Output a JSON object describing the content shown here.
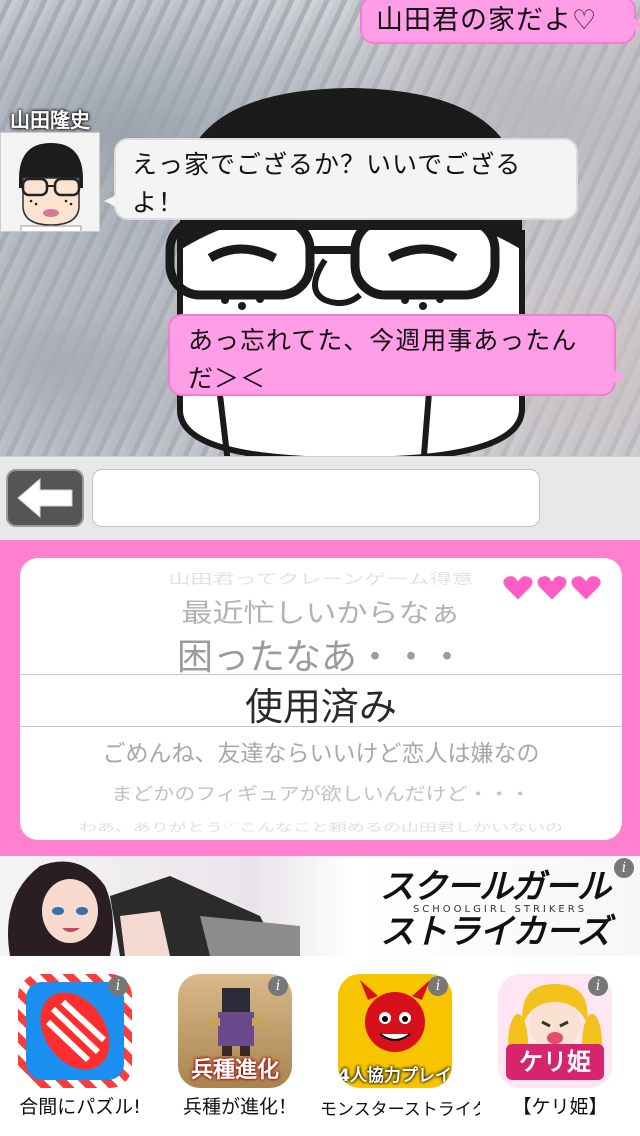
{
  "chat": {
    "messages": [
      {
        "side": "right",
        "text": "山田君の家だよ♡"
      },
      {
        "side": "left",
        "text": "えっ家でござるか？いいでござるよ！"
      },
      {
        "side": "right",
        "text": "あっ忘れてた、今週用事あったんだ＞＜"
      }
    ],
    "sender_name": "山田隆史"
  },
  "input": {
    "value": "",
    "placeholder": ""
  },
  "picker": {
    "options": [
      "山田君ってクレーンゲーム得意",
      "最近忙しいからなぁ",
      "困ったなあ・・・",
      "使用済み",
      "ごめんね、友達ならいいけど恋人は嫌なの",
      "まどかのフィギュアが欲しいんだけど・・・",
      "わあ、ありがとう♡こんなこと頼めるの山田君しかいないの"
    ],
    "selected_index": 3,
    "hearts": "❤❤❤"
  },
  "banner": {
    "title": "スクールガール",
    "subtitle": "SCHOOLGIRL STRIKERS",
    "title2": "ストライカーズ",
    "info": "i"
  },
  "apps": [
    {
      "label": "合間にパズル!",
      "icon_text": "",
      "info": "i"
    },
    {
      "label": "兵種が進化！",
      "icon_text": "兵種進化",
      "info": "i"
    },
    {
      "label": "モンスターストライク",
      "icon_text": "4人協力プレイ",
      "info": "i"
    },
    {
      "label": "【ケリ姫】",
      "icon_text": "ケリ姫",
      "info": "i"
    }
  ],
  "colors": {
    "bubble_right": "#ff9ee6",
    "bubble_left": "#f4f4f4",
    "picker_frame": "#ff80cf",
    "heart": "#ff5cc6"
  }
}
